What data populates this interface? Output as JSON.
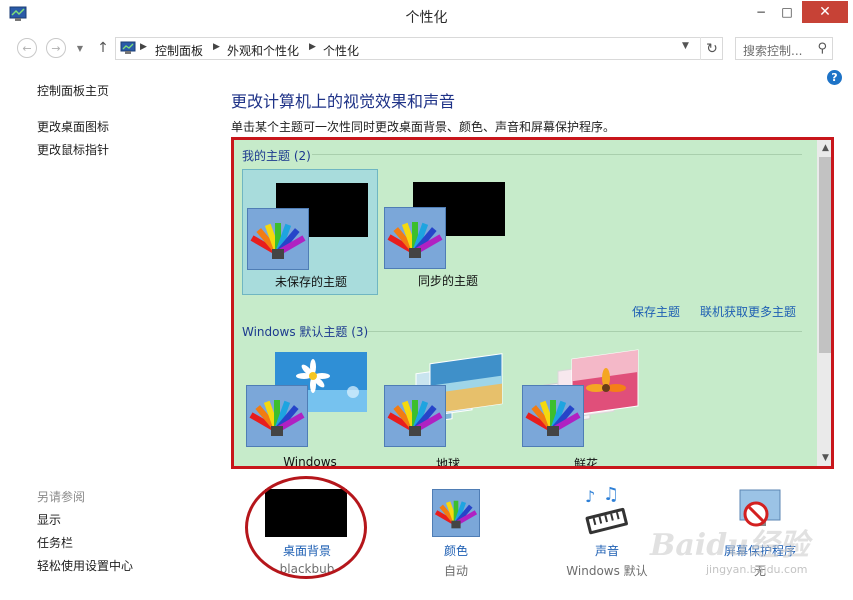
{
  "window": {
    "title": "个性化"
  },
  "window_controls": {
    "minimize": "−",
    "maximize": "□",
    "close": "✕"
  },
  "address_bar": {
    "breadcrumbs": [
      "控制面板",
      "外观和个性化",
      "个性化"
    ],
    "search_placeholder": "搜索控制..."
  },
  "sidebar": {
    "home": "控制面板主页",
    "links": [
      "更改桌面图标",
      "更改鼠标指针"
    ],
    "see_also_label": "另请参阅",
    "see_also": [
      "显示",
      "任务栏",
      "轻松使用设置中心"
    ]
  },
  "main": {
    "heading": "更改计算机上的视觉效果和声音",
    "description": "单击某个主题可一次性同时更改桌面背景、颜色、声音和屏幕保护程序。"
  },
  "themes": {
    "my_group_title": "我的主题 (2)",
    "my_themes": [
      {
        "name": "未保存的主题",
        "selected": true
      },
      {
        "name": "同步的主题",
        "selected": false
      }
    ],
    "save_link": "保存主题",
    "online_link": "联机获取更多主题",
    "default_group_title": "Windows 默认主题 (3)",
    "default_themes": [
      {
        "name": "Windows"
      },
      {
        "name": "地球"
      },
      {
        "name": "鲜花"
      }
    ]
  },
  "bottom": [
    {
      "label": "桌面背景",
      "sub": "blackbub"
    },
    {
      "label": "颜色",
      "sub": "自动"
    },
    {
      "label": "声音",
      "sub": "Windows 默认"
    },
    {
      "label": "屏幕保护程序",
      "sub": "无"
    }
  ],
  "watermark": {
    "logo": "Baidu经验",
    "url": "jingyan.baidu.com"
  },
  "colors": {
    "panel_bg": "#c6ebca",
    "highlight_border": "#c8161b",
    "link": "#1e5fb3",
    "heading": "#1e3287"
  }
}
